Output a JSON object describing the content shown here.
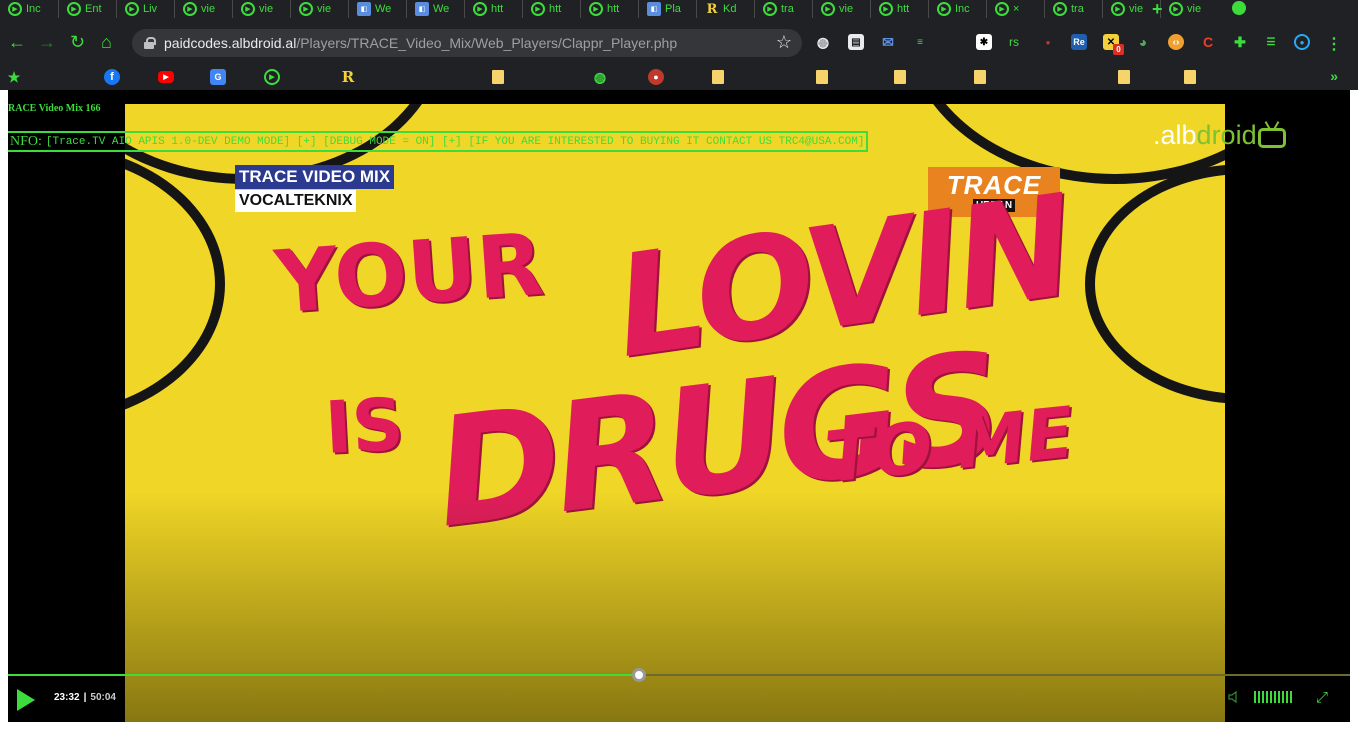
{
  "browser": {
    "tabs": [
      {
        "title": "Inc",
        "icon": "circle-play-icon"
      },
      {
        "title": "Ent",
        "icon": "circle-play-icon"
      },
      {
        "title": "Liv",
        "icon": "circle-play-icon"
      },
      {
        "title": "vie",
        "icon": "circle-play-icon"
      },
      {
        "title": "vie",
        "icon": "circle-play-icon"
      },
      {
        "title": "vie",
        "icon": "circle-play-icon"
      },
      {
        "title": "We",
        "icon": "web-icon"
      },
      {
        "title": "We",
        "icon": "web-icon"
      },
      {
        "title": "htt",
        "icon": "circle-play-icon"
      },
      {
        "title": "htt",
        "icon": "circle-play-icon"
      },
      {
        "title": "htt",
        "icon": "circle-play-icon"
      },
      {
        "title": "Pla",
        "icon": "web-icon"
      },
      {
        "title": "Kd",
        "icon": "r-icon"
      },
      {
        "title": "tra",
        "icon": "circle-play-icon"
      },
      {
        "title": "vie",
        "icon": "circle-play-icon"
      },
      {
        "title": "htt",
        "icon": "circle-play-icon"
      },
      {
        "title": "Inc",
        "icon": "circle-play-icon"
      },
      {
        "title": "×",
        "icon": "circle-play-icon"
      },
      {
        "title": "tra",
        "icon": "circle-play-icon"
      },
      {
        "title": "vie",
        "icon": "circle-play-icon"
      },
      {
        "title": "vie",
        "icon": "circle-play-icon"
      }
    ],
    "url_host": "paidcodes.albdroid.al",
    "url_path": "/Players/TRACE_Video_Mix/Web_Players/Clappr_Player.php",
    "extensions": [
      "rs",
      "Re",
      "0",
      "C"
    ],
    "accent": "#3ddc3d"
  },
  "page": {
    "video_title": "RACE Video Mix 166",
    "info_label": "NFO:",
    "info_text": "[Trace.TV AIO APIS 1.0-DEV DEMO MODE] [+] [DEBUG MODE = ON] [+] [IF YOU ARE INTERESTED TO BUYING IT CONTACT US TRC4@USA.COM]",
    "watermark_a": ".alb",
    "watermark_b": "droid"
  },
  "video_frame": {
    "mix_line1": "TRACE VIDEO MIX",
    "mix_line2": "VOCALTEKNIX",
    "channel_main": "TRACE",
    "channel_sub": "URBAN",
    "lyric_1": "YOUR",
    "lyric_2": "LOVIN",
    "lyric_3": "IS",
    "lyric_4": "DRUGS",
    "lyric_5": "TO ME"
  },
  "player": {
    "current_time": "23:32",
    "separator": "|",
    "duration": "50:04",
    "progress_fraction": 0.47,
    "volume_level": 1.0
  }
}
